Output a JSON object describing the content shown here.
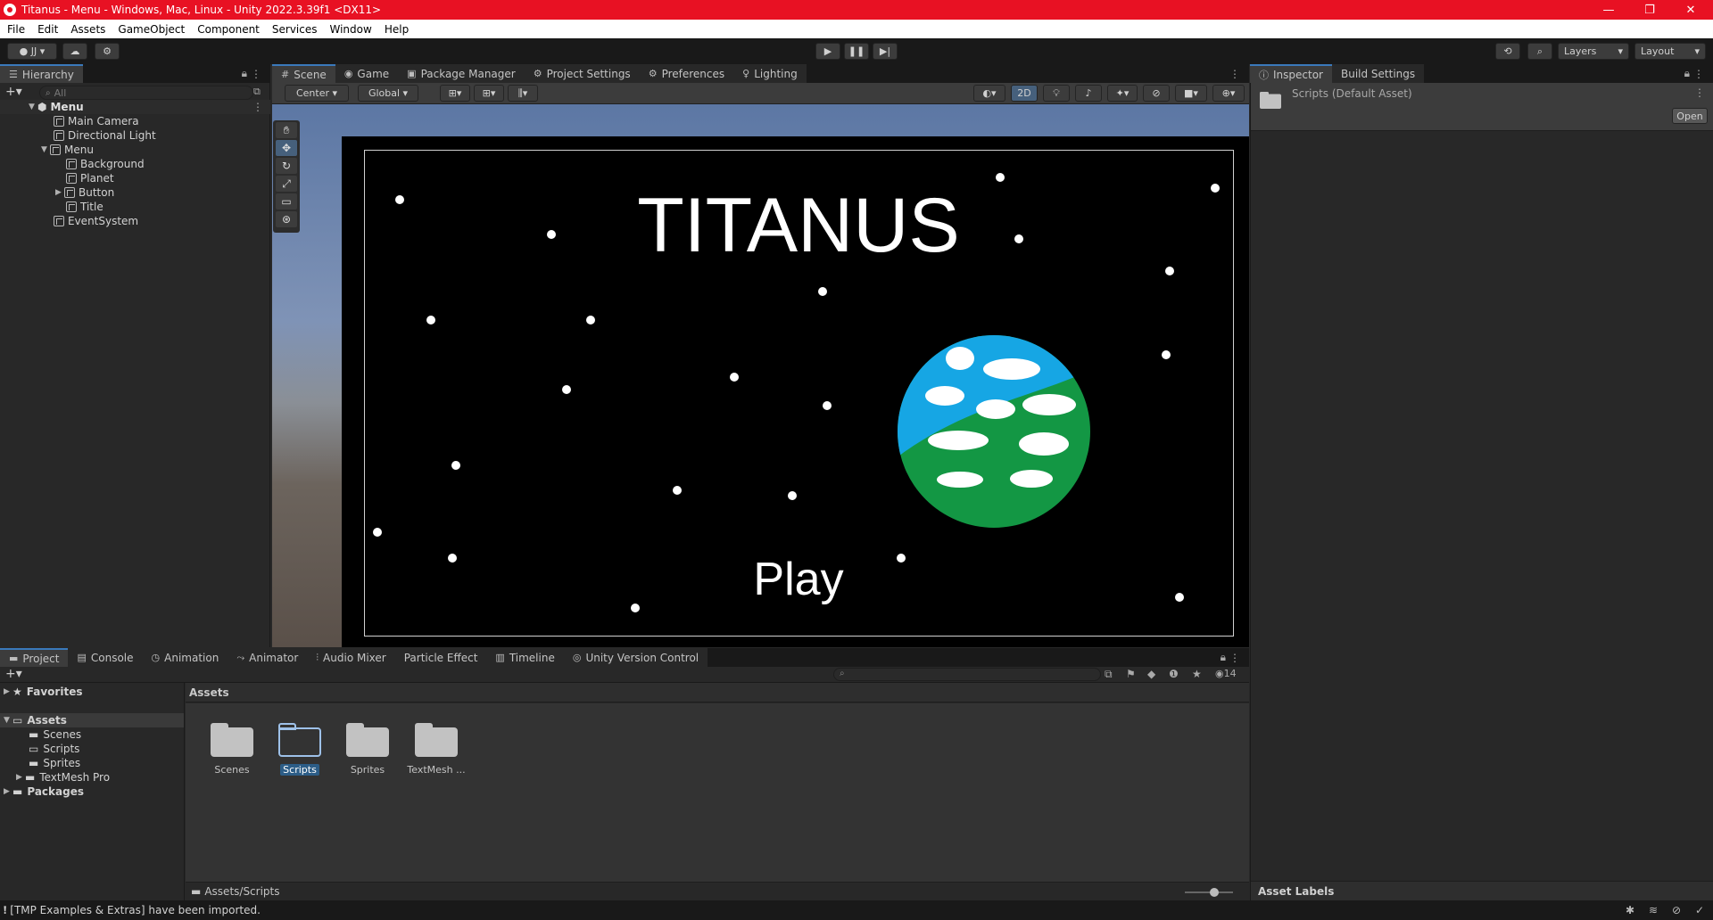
{
  "window": {
    "title": "Titanus - Menu - Windows, Mac, Linux - Unity 2022.3.39f1 <DX11>",
    "controls": [
      "—",
      "❐",
      "✕"
    ]
  },
  "menubar": [
    "File",
    "Edit",
    "Assets",
    "GameObject",
    "Component",
    "Services",
    "Window",
    "Help"
  ],
  "toolbar": {
    "account": "JJ",
    "layers": "Layers",
    "layout": "Layout"
  },
  "hierarchy": {
    "tab": "Hierarchy",
    "search_placeholder": "All",
    "scene": "Menu",
    "items": [
      {
        "label": "Main Camera"
      },
      {
        "label": "Directional Light"
      },
      {
        "label": "Menu"
      },
      {
        "label": "Background"
      },
      {
        "label": "Planet"
      },
      {
        "label": "Button"
      },
      {
        "label": "Title"
      },
      {
        "label": "EventSystem"
      }
    ]
  },
  "scene_tabs": [
    "Scene",
    "Game",
    "Package Manager",
    "Project Settings",
    "Preferences",
    "Lighting"
  ],
  "scene_toolbar": {
    "pivot": "Center",
    "space": "Global",
    "mode2d": "2D"
  },
  "game": {
    "title": "TITANUS",
    "play": "Play"
  },
  "inspector": {
    "tabs": [
      "Inspector",
      "Build Settings"
    ],
    "asset_name": "Scripts (Default Asset)",
    "open_button": "Open",
    "asset_labels": "Asset Labels"
  },
  "bottom_tabs": [
    "Project",
    "Console",
    "Animation",
    "Animator",
    "Audio Mixer",
    "Particle Effect",
    "Timeline",
    "Unity Version Control"
  ],
  "project": {
    "favorites": "Favorites",
    "assets": "Assets",
    "asset_folders": [
      "Scenes",
      "Scripts",
      "Sprites",
      "TextMesh Pro"
    ],
    "packages": "Packages",
    "breadcrumb": "Assets",
    "grid": [
      {
        "label": "Scenes",
        "selected": false
      },
      {
        "label": "Scripts",
        "selected": true
      },
      {
        "label": "Sprites",
        "selected": false
      },
      {
        "label": "TextMesh ...",
        "selected": false
      }
    ],
    "path": "Assets/Scripts",
    "hidden_count": "14"
  },
  "status": {
    "message": "[TMP Examples & Extras] have been imported."
  },
  "colors": {
    "titlebar": "#e81123",
    "accent": "#3a79bb",
    "planet_ocean": "#16a6e4",
    "planet_land": "#139744"
  }
}
